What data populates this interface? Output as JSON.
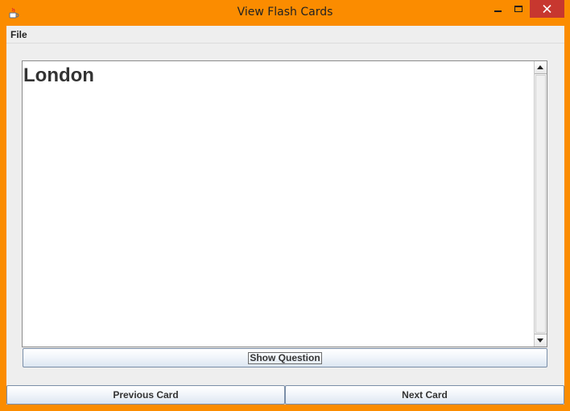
{
  "window": {
    "title": "View Flash Cards",
    "frame_color": "#fb8c00",
    "close_color": "#c7372f"
  },
  "icons": {
    "app": "java-coffee-icon",
    "minimize": "minimize-icon",
    "maximize": "maximize-icon",
    "close": "close-icon",
    "scroll_up": "arrow-up-icon",
    "scroll_down": "arrow-down-icon"
  },
  "menubar": {
    "file_label": "File"
  },
  "card": {
    "text": "London"
  },
  "buttons": {
    "show_question": "Show Question",
    "previous": "Previous Card",
    "next": "Next Card"
  }
}
